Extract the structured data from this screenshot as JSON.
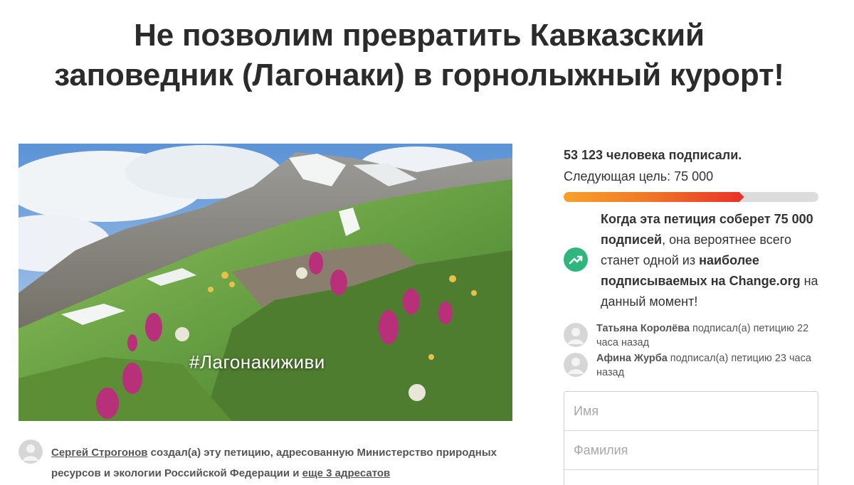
{
  "petition": {
    "title_line1": "Не позволим превратить Кавказский",
    "title_line2": "заповедник (Лагонаки) в горнолыжный курорт!",
    "image_caption": "#Лагонакиживи"
  },
  "creator": {
    "name": "Сергей Строгонов",
    "text_before": " создал(а) эту петицию, адресованную Министерство природных ресурсов и экологии Российской Федерации и ",
    "more_link": "еще 3 адресатов"
  },
  "stats": {
    "signed_count": "53 123 человека подписали.",
    "next_goal": "Следующая цель: 75 000",
    "progress_fraction": 0.7083
  },
  "milestone": {
    "part1_bold": "Когда эта петиция соберет 75 000 подписей",
    "part2": ", она вероятнее всего станет одной из ",
    "part3_bold": "наиболее подписываемых на Change.org",
    "part4": " на данный момент!"
  },
  "recent_signers": [
    {
      "name": "Татьяна Королёва",
      "action": " подписал(а) петицию 22 часа назад"
    },
    {
      "name": "Афина Журба",
      "action": " подписал(а) петицию 23 часа назад"
    }
  ],
  "form": {
    "first_name_placeholder": "Имя",
    "last_name_placeholder": "Фамилия"
  },
  "colors": {
    "progress_start": "#f6a12a",
    "progress_end": "#e8302a",
    "trend_icon_bg": "#2eb67d"
  },
  "icons": {
    "trend": "trending-up-icon",
    "avatar": "user-avatar-placeholder"
  }
}
